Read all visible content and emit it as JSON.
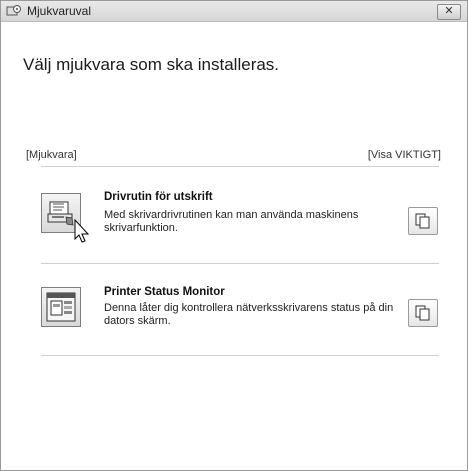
{
  "window": {
    "title": "Mjukvaruval",
    "close_label": "✕"
  },
  "heading": "Välj mjukvara som ska installeras.",
  "section": {
    "left_label": "[Mjukvara]",
    "right_label": "[Visa VIKTIGT]"
  },
  "items": [
    {
      "title": "Drivrutin för utskrift",
      "description": "Med skrivardrivrutinen kan man använda maskinens skrivarfunktion.",
      "icon": "printer-driver-icon"
    },
    {
      "title": "Printer Status Monitor",
      "description": "Denna låter dig kontrollera nätverksskrivarens status på din dators skärm.",
      "icon": "status-monitor-icon"
    }
  ]
}
